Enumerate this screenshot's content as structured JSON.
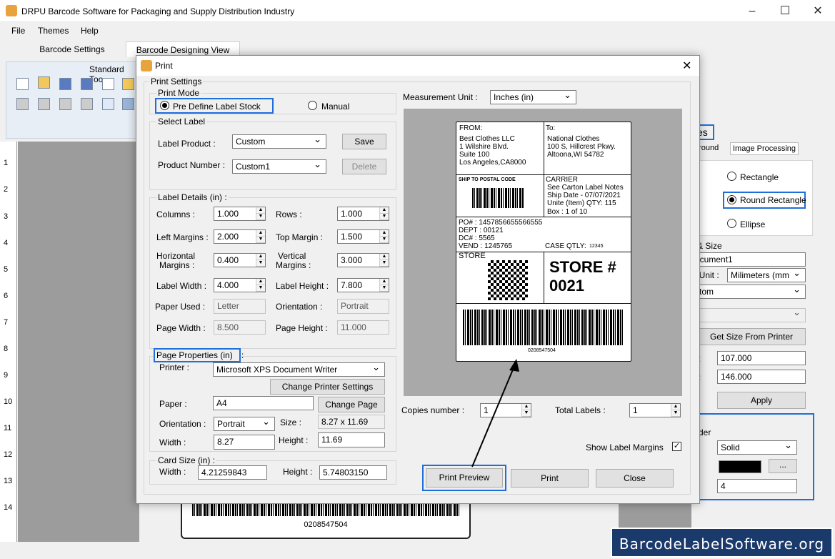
{
  "app": {
    "title": "DRPU Barcode Software for Packaging and Supply Distribution Industry"
  },
  "menu": [
    "File",
    "Themes",
    "Help"
  ],
  "tabs": [
    "Barcode Settings",
    "Barcode Designing View"
  ],
  "toolbar": {
    "label": "Standard Too"
  },
  "ruler": [
    "1",
    "2",
    "3",
    "4",
    "5",
    "6",
    "7",
    "8",
    "9",
    "10",
    "11",
    "12",
    "13",
    "14"
  ],
  "canvas": {
    "barcode_number": "0208547504"
  },
  "right_panel": {
    "partial_title": "es",
    "tabs": [
      "ground",
      "Image Processing"
    ],
    "shapes": [
      "Rectangle",
      "Round Rectangle",
      "Ellipse"
    ],
    "size_heading": "& Size",
    "doc_name": "ocument1",
    "unit_label": "t Unit :",
    "unit_value": "Milimeters (mm",
    "custom": "stom",
    "get_size": "Get Size From Printer",
    "width": "107.000",
    "height": "146.000",
    "apply": "Apply",
    "border_label": "rder",
    "border_style": "Solid",
    "dots": "...",
    "border_width": "4"
  },
  "dialog": {
    "title": "Print",
    "print_settings": "Print Settings",
    "print_mode": "Print Mode",
    "pre_define": "Pre Define Label Stock",
    "manual": "Manual",
    "select_label": "Select Label",
    "label_product": "Label Product :",
    "label_product_value": "Custom",
    "save": "Save",
    "product_number": "Product Number :",
    "product_number_value": "Custom1",
    "delete": "Delete",
    "label_details": "Label Details (in) :",
    "columns_label": "Columns :",
    "columns": "1.000",
    "rows_label": "Rows :",
    "rows": "1.000",
    "left_margins_label": "Left Margins :",
    "left_margins": "2.000",
    "top_margin_label": "Top Margin :",
    "top_margin": "1.500",
    "hmargins_label_1": "Horizontal",
    "hmargins_label_2": "Margins :",
    "hmargins": "0.400",
    "vmargins_label_1": "Vertical",
    "vmargins_label_2": "Margins :",
    "vmargins": "3.000",
    "label_width_label": "Label Width :",
    "label_width": "4.000",
    "label_height_label": "Label Height :",
    "label_height": "7.800",
    "paper_used_label": "Paper Used :",
    "paper_used": "Letter",
    "orientation_label": "Orientation :",
    "orientation": "Portrait",
    "page_width_label": "Page Width :",
    "page_width": "8.500",
    "page_height_label": "Page Height :",
    "page_height": "11.000",
    "page_props": "Page Properties (in)",
    "page_props_colon": ":",
    "printer_label": "Printer :",
    "printer": "Microsoft XPS Document Writer",
    "change_printer": "Change Printer Settings",
    "paper_label": "Paper :",
    "paper": "A4",
    "change_page": "Change Page",
    "orient2_label": "Orientation :",
    "orient2": "Portrait",
    "size_label": "Size :",
    "size": "8.27 x 11.69",
    "width_label": "Width :",
    "width": "8.27",
    "height_label": "Height :",
    "height": "11.69",
    "card_size": "Card Size (in) :",
    "card_width_label": "Width :",
    "card_width": "4.21259843",
    "card_height_label": "Height :",
    "card_height": "5.74803150",
    "measurement_label": "Measurement Unit :",
    "measurement": "Inches (in)",
    "copies_label": "Copies number :",
    "copies": "1",
    "total_label": "Total Labels :",
    "total": "1",
    "show_margins": "Show Label Margins",
    "print_preview": "Print Preview",
    "print": "Print",
    "close": "Close"
  },
  "preview": {
    "from_title": "FROM:",
    "from_lines": [
      "Best Clothes LLC",
      "1 Wilshire Blvd.",
      "Suite 100",
      "Los Angeles,CA8000"
    ],
    "to_title": "To:",
    "to_lines": [
      "National Clothes",
      "100 S, Hillcrest Pkwy.",
      "Altoona,WI 54782"
    ],
    "ship_to": "SHIP TO POSTAL CODE",
    "carrier_lines": [
      "CARRIER",
      "See Carton Label Notes",
      "Ship Date - 07/07/2021",
      "Unite (Item) QTY: 115",
      "Box : 1 of 10"
    ],
    "po": "PO#   :  1457856655566555",
    "dept": "DEPT  :  00121",
    "dc": "DC#   :  5565",
    "vend": "VEND :  1245765",
    "case_qty": "CASE QTLY:",
    "case_qty_val": "12345",
    "store": "STORE",
    "store_num_1": "STORE #",
    "store_num_2": "0021",
    "barcode_number": "0208547504"
  },
  "watermark": "BarcodeLabelSoftware.org"
}
